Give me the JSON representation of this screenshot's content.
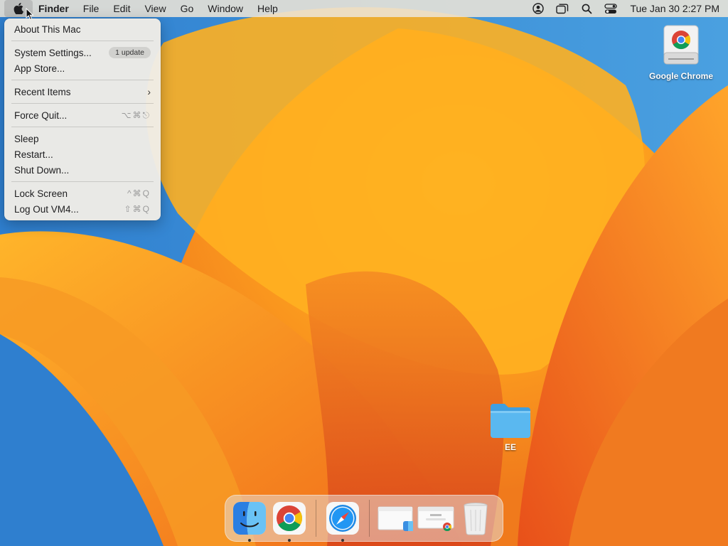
{
  "menubar": {
    "app_name": "Finder",
    "menus": [
      "File",
      "Edit",
      "View",
      "Go",
      "Window",
      "Help"
    ],
    "clock": "Tue Jan 30  2:27 PM",
    "status_icons": [
      "user-icon",
      "screen-mirroring-icon",
      "spotlight-search-icon",
      "control-center-icon"
    ]
  },
  "apple_menu": {
    "items": [
      {
        "label": "About This Mac"
      },
      {
        "label": "System Settings...",
        "badge": "1 update"
      },
      {
        "label": "App Store..."
      },
      {
        "label": "Recent Items",
        "submenu": "›"
      },
      {
        "label": "Force Quit...",
        "shortcut": "⌥⌘⎋"
      },
      {
        "label": "Sleep"
      },
      {
        "label": "Restart..."
      },
      {
        "label": "Shut Down..."
      },
      {
        "label": "Lock Screen",
        "shortcut": "^⌘Q"
      },
      {
        "label": "Log Out VM4...",
        "shortcut": "⇧⌘Q"
      }
    ]
  },
  "desktop": {
    "chrome_drive_label": "Google Chrome",
    "folder_label": "EE"
  },
  "dock": {
    "apps": [
      "Finder",
      "Google Chrome",
      "Safari"
    ],
    "icons": [
      "finder-icon",
      "chrome-icon",
      "safari-icon",
      "finder-window-thumbnail",
      "chrome-window-thumbnail",
      "trash-icon"
    ]
  },
  "colors": {
    "wallpaper_orange": "#f28b2a",
    "wallpaper_blue": "#3a8fd6",
    "folder_blue": "#5ab8f0"
  }
}
